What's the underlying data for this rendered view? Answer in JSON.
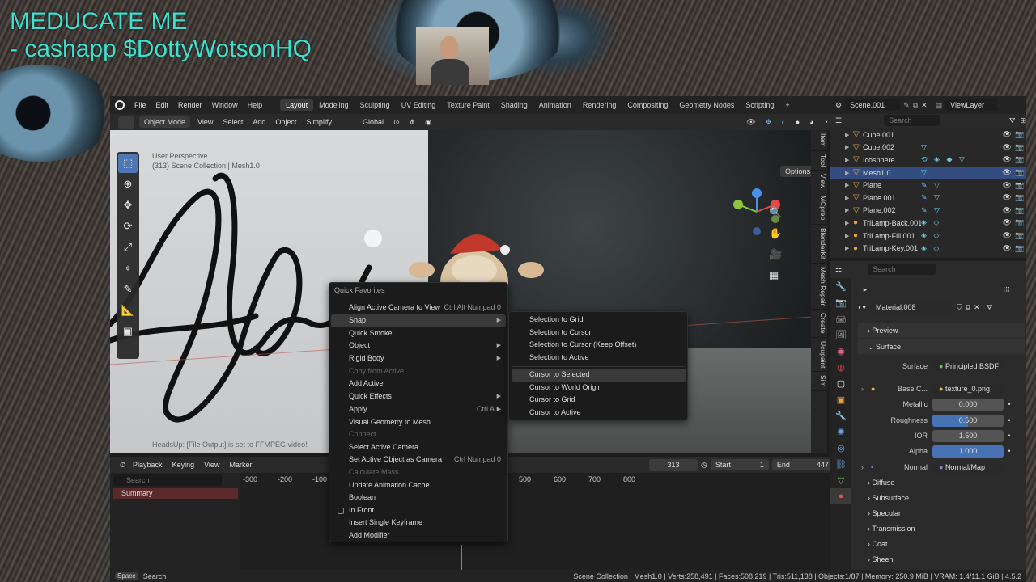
{
  "overlay": {
    "title_line1": "MEDUCATE ME",
    "title_line2": "- cashapp $DottyWotsonHQ"
  },
  "menubar": {
    "menus": [
      "File",
      "Edit",
      "Render",
      "Window",
      "Help"
    ],
    "workspaces": [
      "Layout",
      "Modeling",
      "Sculpting",
      "UV Editing",
      "Texture Paint",
      "Shading",
      "Animation",
      "Rendering",
      "Compositing",
      "Geometry Nodes",
      "Scripting"
    ],
    "active_workspace": "Layout",
    "scene": "Scene.001",
    "view_layer": "ViewLayer"
  },
  "viewport_header": {
    "mode": "Object Mode",
    "menus": [
      "View",
      "Select",
      "Add",
      "Object"
    ],
    "simplify": "Simplify",
    "orientation": "Global",
    "options": "Options"
  },
  "viewport": {
    "perspective": "User Perspective",
    "collection": "(313) Scene Collection | Mesh1.0",
    "headsup": "HeadsUp: [File Output] is set to FFMPEG video!",
    "side_tabs": [
      "Item",
      "Tool",
      "View",
      "MCprep",
      "BlenderKit",
      "Mesh Repair",
      "Create",
      "Ucupaint",
      "Sim"
    ]
  },
  "quick_favorites": {
    "title": "Quick Favorites",
    "items": [
      {
        "label": "Align Active Camera to View",
        "shortcut": "Ctrl Alt Numpad 0"
      },
      {
        "label": "Snap",
        "submenu": true,
        "highlighted": true
      },
      {
        "label": "Quick Smoke"
      },
      {
        "label": "Object",
        "submenu": true
      },
      {
        "label": "Rigid Body",
        "submenu": true
      },
      {
        "label": "Copy from Active",
        "disabled": true
      },
      {
        "label": "Add Active"
      },
      {
        "label": "Quick Effects",
        "submenu": true
      },
      {
        "label": "Apply",
        "shortcut": "Ctrl A",
        "submenu": true
      },
      {
        "label": "Visual Geometry to Mesh"
      },
      {
        "label": "Connect",
        "disabled": true
      },
      {
        "label": "Select Active Camera"
      },
      {
        "label": "Set Active Object as Camera",
        "shortcut": "Ctrl Numpad 0"
      },
      {
        "label": "Calculate Mass",
        "disabled": true
      },
      {
        "label": "Update Animation Cache"
      },
      {
        "label": "Boolean"
      },
      {
        "label": "In Front",
        "checkbox": true
      },
      {
        "label": "Insert Single Keyframe"
      },
      {
        "label": "Add Modifier"
      }
    ]
  },
  "snap_submenu": {
    "items": [
      {
        "label": "Selection to Grid"
      },
      {
        "label": "Selection to Cursor"
      },
      {
        "label": "Selection to Cursor (Keep Offset)"
      },
      {
        "label": "Selection to Active"
      },
      {
        "label": "Cursor to Selected",
        "highlighted": true
      },
      {
        "label": "Cursor to World Origin"
      },
      {
        "label": "Cursor to Grid"
      },
      {
        "label": "Cursor to Active"
      }
    ]
  },
  "timeline": {
    "menus": [
      "Playback",
      "Keying",
      "View",
      "Marker"
    ],
    "current_frame": "313",
    "start_label": "Start",
    "start": "1",
    "end_label": "End",
    "end": "447",
    "search_placeholder": "Search",
    "summary": "Summary",
    "ruler": [
      "-300",
      "-200",
      "-100",
      "500",
      "600",
      "700",
      "800"
    ]
  },
  "statusbar": {
    "key": "Space",
    "action": "Search",
    "stats": "Scene Collection | Mesh1.0 | Verts:258,491 | Faces:508,219 | Tris:511,138 | Objects:1/87 | Memory: 250.9 MiB | VRAM: 1.4/11.1 GiB | 4.5.2"
  },
  "outliner": {
    "search_placeholder": "Search",
    "rows": [
      {
        "name": "Cube.001",
        "mods": "",
        "icon": "mesh"
      },
      {
        "name": "Cube.002",
        "mods": "▽",
        "icon": "mesh"
      },
      {
        "name": "Icosphere",
        "mods": "⟲ ◈ ◆ ▽",
        "icon": "mesh"
      },
      {
        "name": "Mesh1.0",
        "mods": "▽",
        "icon": "mesh",
        "selected": true
      },
      {
        "name": "Plane",
        "mods": "✎ ▽",
        "icon": "mesh"
      },
      {
        "name": "Plane.001",
        "mods": "✎ ▽",
        "icon": "mesh"
      },
      {
        "name": "Plane.002",
        "mods": "✎ ▽",
        "icon": "mesh"
      },
      {
        "name": "TriLamp-Back.001",
        "mods": "◈ ◇",
        "icon": "light"
      },
      {
        "name": "TriLamp-Fill.001",
        "mods": "◈ ◇",
        "icon": "light"
      },
      {
        "name": "TriLamp-Key.001",
        "mods": "◈ ◇",
        "icon": "light"
      }
    ]
  },
  "properties": {
    "search_placeholder": "Search",
    "material": "Material.008",
    "sections": {
      "preview": "Preview",
      "surface": "Surface"
    },
    "surface_label": "Surface",
    "surface_value": "Principled BSDF",
    "base_color_label": "Base C...",
    "base_color_value": "texture_0.png",
    "metallic_label": "Metallic",
    "metallic": "0.000",
    "roughness_label": "Roughness",
    "roughness": "0.500",
    "ior_label": "IOR",
    "ior": "1.500",
    "alpha_label": "Alpha",
    "alpha": "1.000",
    "normal_label": "Normal",
    "normal_value": "Normal/Map",
    "subsections": [
      "Diffuse",
      "Subsurface",
      "Specular",
      "Transmission",
      "Coat",
      "Sheen"
    ]
  },
  "colors": {
    "accent": "#4772b3",
    "overlay_text": "#3fe0d0",
    "selected_row": "#334d80"
  }
}
